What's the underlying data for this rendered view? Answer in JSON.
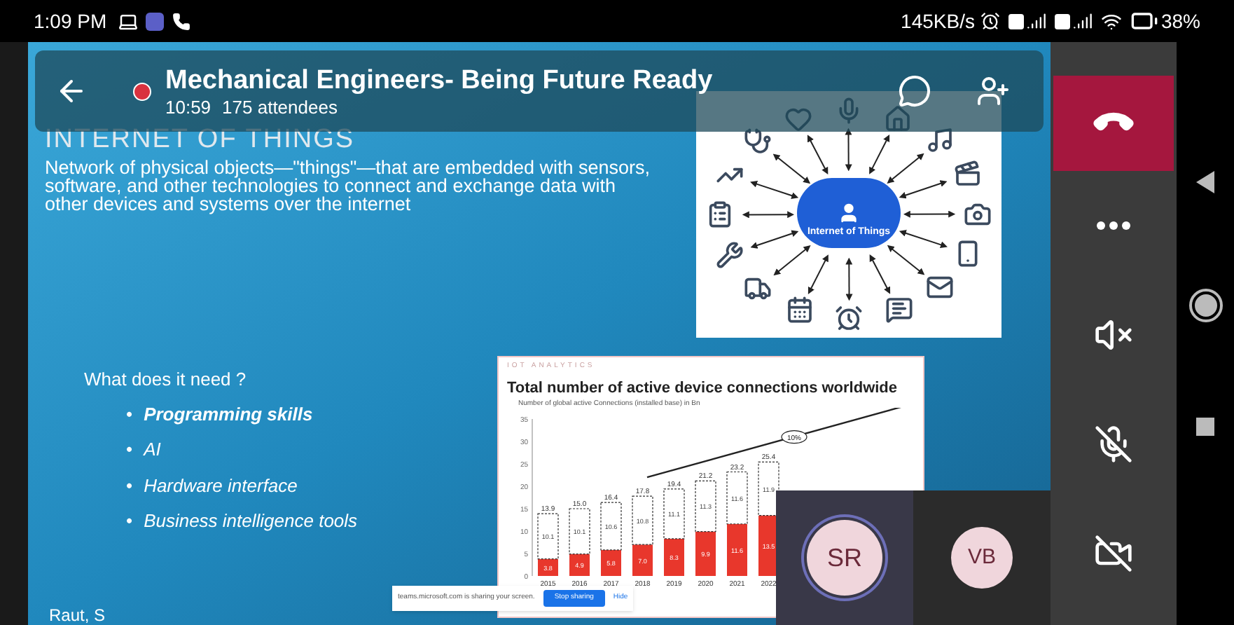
{
  "status_bar": {
    "time": "1:09 PM",
    "speed": "145KB/s",
    "battery": "38%"
  },
  "meeting": {
    "title": "Mechanical Engineers- Being Future Ready",
    "duration": "10:59",
    "attendees": "175 attendees",
    "recording": true
  },
  "slide": {
    "title": "INTERNET OF THINGS",
    "paragraph": "Network of physical objects—\"things\"—that are embedded with sensors, software, and other technologies to connect and exchange data with other devices and systems over the internet",
    "diagram_label": "Internet of Things",
    "question": "What does it need ?",
    "bullets": [
      {
        "marker": "•",
        "text": "Programming skills",
        "bold": true
      },
      {
        "marker": "•",
        "text": "AI",
        "bold": false
      },
      {
        "marker": "•",
        "text": "Hardware interface",
        "bold": false
      },
      {
        "marker": "•",
        "text": "Business intelligence tools",
        "bold": false
      }
    ],
    "chart_card": {
      "brand": "IOT ANALYTICS",
      "title": "Total number of active device connections worldwide",
      "chart_data": {
        "type": "bar",
        "ylabel": "Number of global active Connections (installed base) in Bn",
        "categories": [
          "2015",
          "2016",
          "2017",
          "2018",
          "2019",
          "2020",
          "2021",
          "2022"
        ],
        "stacked": true,
        "value_labels": [
          [
            "3.8",
            "4.9",
            "5.8",
            "7.0",
            "8.3",
            "9.9",
            "11.6",
            "13.5"
          ],
          [
            "10.1",
            "10.1",
            "10.6",
            "10.8",
            "11.1",
            "11.3",
            "11.6",
            "11.9"
          ]
        ],
        "series": [
          {
            "color": "#e8372c",
            "values": [
              3.8,
              4.9,
              5.8,
              7.0,
              8.3,
              9.9,
              11.6,
              13.5
            ]
          },
          {
            "color": "#ffffff",
            "values": [
              10.1,
              10.1,
              10.6,
              10.8,
              11.1,
              11.3,
              11.6,
              11.9
            ]
          }
        ],
        "totals": [
          "13.9",
          "15.0",
          "16.4",
          "17.8",
          "19.4",
          "21.2",
          "23.2",
          "25.4"
        ],
        "ylim": [
          0,
          35
        ],
        "yticks": [
          0,
          5,
          10,
          15,
          20,
          25,
          30,
          35
        ],
        "annotations": [
          "10%"
        ]
      }
    },
    "author": "Raut, S"
  },
  "share_bar": {
    "message": "teams.microsoft.com is sharing your screen.",
    "stop": "Stop sharing",
    "hide": "Hide"
  },
  "participants": [
    {
      "initials": "SR",
      "speaking": true
    },
    {
      "initials": "VB",
      "speaking": false
    }
  ],
  "controls": [
    {
      "kind": "more"
    },
    {
      "kind": "speaker",
      "on": false
    },
    {
      "kind": "mic",
      "on": false
    },
    {
      "kind": "camera",
      "on": false
    }
  ]
}
